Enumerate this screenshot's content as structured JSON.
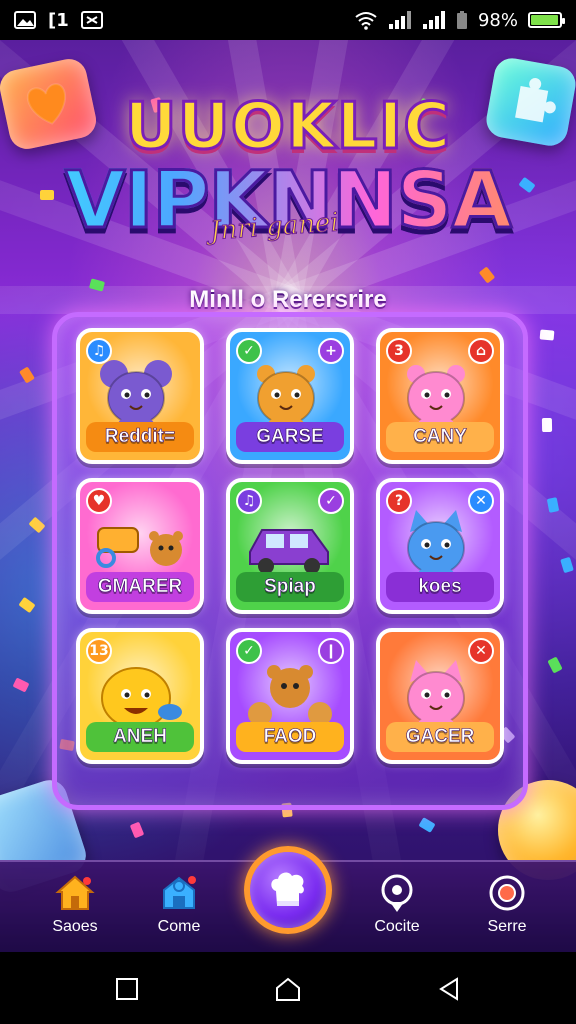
{
  "status_bar": {
    "left_text": "[1",
    "battery_text": "98%",
    "battery_level": 0.98,
    "battery_color": "#7ee04a",
    "icons": [
      "gallery-icon",
      "sim-card-icon",
      "screenshot-icon",
      "wifi-icon",
      "signal-icon",
      "signal-icon",
      "battery-saver-icon",
      "battery-icon"
    ]
  },
  "logo": {
    "line1": "UUOKLIC",
    "line2": "VIPKNNSA",
    "subtitle": "Jnri ganei"
  },
  "panel": {
    "title": "Minll o Rerersrire",
    "border_color": "#c56bff"
  },
  "tiles": [
    {
      "label": "Reddit=",
      "bg": "#ffb638",
      "label_bg": "#f58b12",
      "badge_left": "♫",
      "badge_left_color": "#2a8cff",
      "creature": "purple-mouse",
      "creature_color": "#7a5ad0"
    },
    {
      "label": "GARSE",
      "bg": "#3aa8ff",
      "label_bg": "#7a3ee0",
      "badge_left": "✓",
      "badge_left_color": "#3ec24a",
      "badge_right": "+",
      "badge_right_color": "#9a3fe0",
      "creature": "orange-bear",
      "creature_color": "#f0a030"
    },
    {
      "label": "CANY",
      "bg": "#ff8a2a",
      "label_bg": "#ffb14a",
      "badge_left": "3",
      "badge_left_color": "#e6332a",
      "badge_right": "⌂",
      "badge_right_color": "#e6332a",
      "creature": "pink-bear",
      "creature_color": "#ff8ad0"
    },
    {
      "label": "GMARER",
      "bg": "#ff6bd0",
      "label_bg": "#c23fe0",
      "badge_left": "♥",
      "badge_left_color": "#e6332a",
      "creature": "key-and-bear",
      "creature_color": "#ffb030"
    },
    {
      "label": "Spiap",
      "bg": "#4fd24a",
      "label_bg": "#2e9e35",
      "badge_left": "♫",
      "badge_left_color": "#7a3ee0",
      "badge_right": "✓",
      "badge_right_color": "#9a3fe0",
      "creature": "purple-car",
      "creature_color": "#8a3fd0"
    },
    {
      "label": "koes",
      "bg": "#b35cff",
      "label_bg": "#8a2fd6",
      "badge_left": "?",
      "badge_left_color": "#e6332a",
      "badge_right": "✕",
      "badge_right_color": "#2a8cff",
      "creature": "blue-cat",
      "creature_color": "#4a9af0"
    },
    {
      "label": "ANEH",
      "bg": "#ffd23a",
      "label_bg": "#4fc23a",
      "badge_left": "13",
      "badge_left_color": "#ff9a1e",
      "creature": "yellow-blob",
      "creature_color": "#ffc81e"
    },
    {
      "label": "FAOD",
      "bg": "#a64cff",
      "label_bg": "#ffb21e",
      "badge_left": "✓",
      "badge_left_color": "#3ec24a",
      "badge_right": "❙",
      "badge_right_color": "#9a3fe0",
      "creature": "bear-family",
      "creature_color": "#d88a30"
    },
    {
      "label": "GACER",
      "bg": "#ff7a3a",
      "label_bg": "#ffb14a",
      "badge_right": "✕",
      "badge_right_color": "#e6332a",
      "creature": "pink-cat",
      "creature_color": "#ff8ad0"
    }
  ],
  "bottom_nav": {
    "items": [
      {
        "label": "Saoes",
        "icon": "home-icon",
        "color": "#ffb21e"
      },
      {
        "label": "Come",
        "icon": "puzzle-home-icon",
        "color": "#3ab0ff"
      },
      {
        "label": "Cocite",
        "icon": "location-icon",
        "color": "#ffffff"
      },
      {
        "label": "Serre",
        "icon": "target-icon",
        "color": "#ffffff"
      }
    ],
    "center_icon": "chef-hat-icon",
    "center_ring_color": "#ff9a2e"
  },
  "system_nav": {
    "buttons": [
      "recents-icon",
      "home-icon",
      "back-icon"
    ]
  }
}
